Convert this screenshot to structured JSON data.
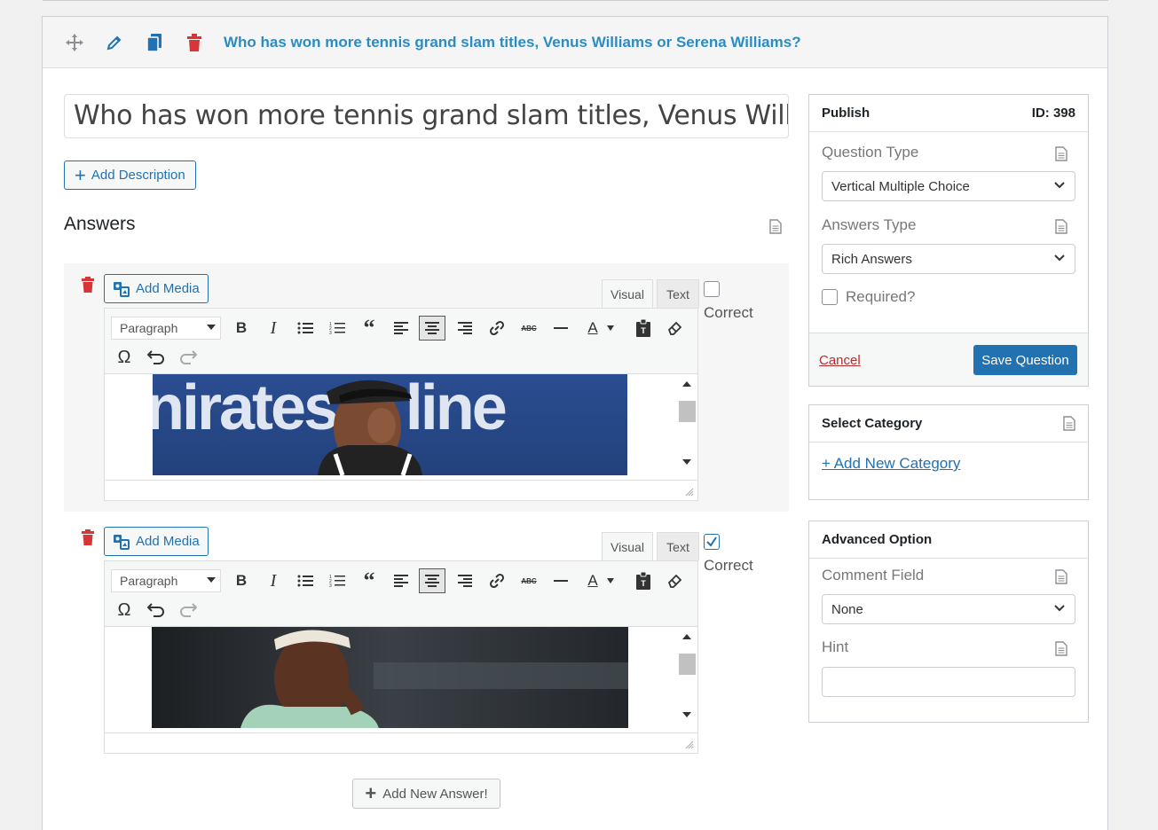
{
  "header": {
    "question_title": "Who has won more tennis grand slam titles, Venus Williams or Serena Williams?"
  },
  "question": {
    "title_value": "Who has won more tennis grand slam titles, Venus Williams or Serena Williams?",
    "add_description_label": "Add Description",
    "answers_heading": "Answers"
  },
  "answers": [
    {
      "add_media_label": "Add Media",
      "tab_visual": "Visual",
      "tab_text": "Text",
      "paragraph_format": "Paragraph",
      "image_caption_text": "nirates A  line",
      "correct_label": "Correct",
      "correct_checked": false
    },
    {
      "add_media_label": "Add Media",
      "tab_visual": "Visual",
      "tab_text": "Text",
      "paragraph_format": "Paragraph",
      "correct_label": "Correct",
      "correct_checked": true
    }
  ],
  "add_new_answer_label": "Add New Answer!",
  "publish": {
    "title": "Publish",
    "id_label": "ID: 398",
    "question_type_label": "Question Type",
    "question_type_value": "Vertical Multiple Choice",
    "answers_type_label": "Answers Type",
    "answers_type_value": "Rich Answers",
    "required_label": "Required?",
    "cancel_label": "Cancel",
    "save_label": "Save Question"
  },
  "category": {
    "title": "Select Category",
    "add_link": "+ Add New Category"
  },
  "advanced": {
    "title": "Advanced Option",
    "comment_field_label": "Comment Field",
    "comment_field_value": "None",
    "hint_label": "Hint",
    "hint_value": ""
  },
  "colors": {
    "accent": "#2271b1",
    "title_blue": "#2b8cc4",
    "danger": "#d63638"
  }
}
